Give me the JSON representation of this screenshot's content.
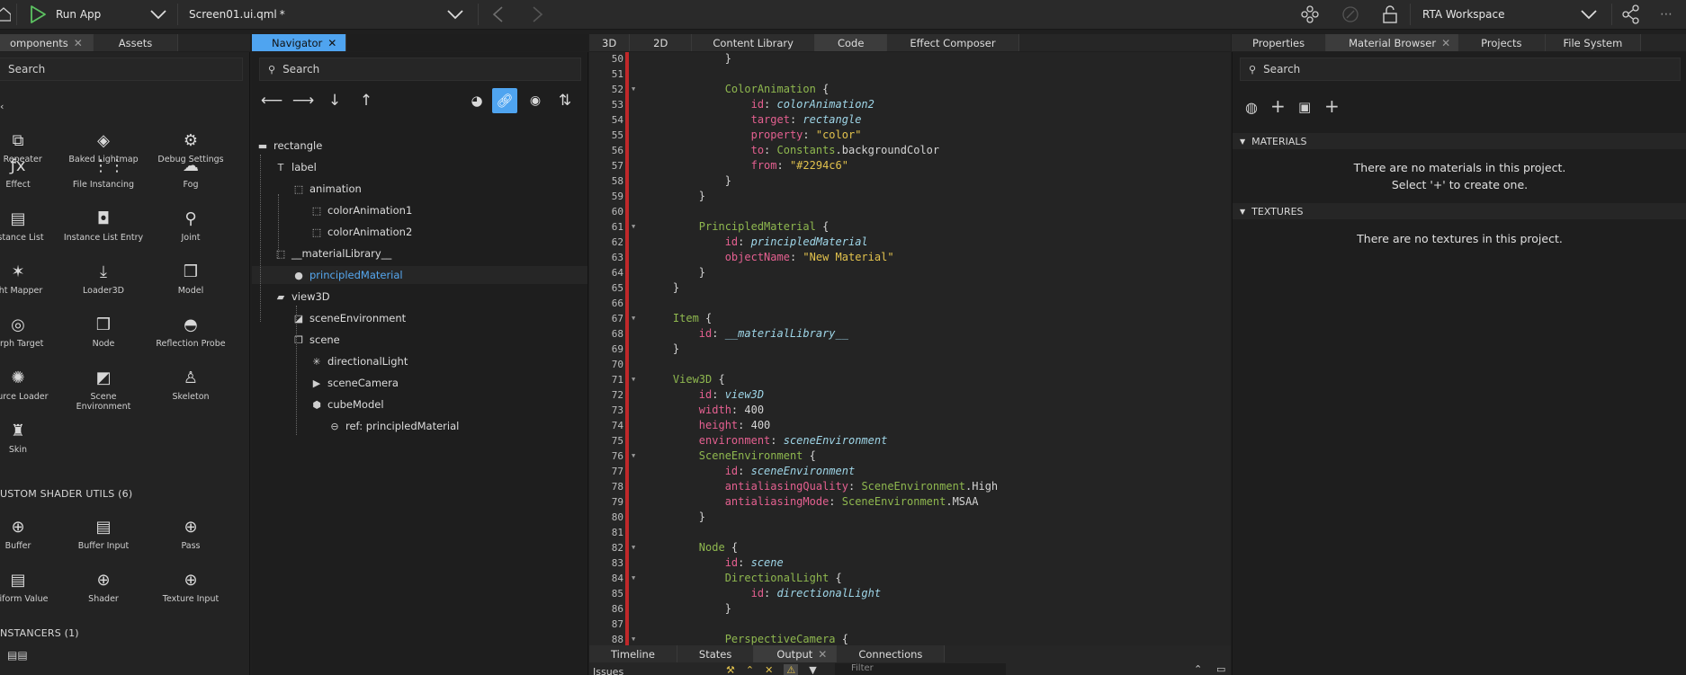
{
  "toolbar": {
    "run_label": "Run App",
    "file": "Screen01.ui.qml",
    "file_modified": "*",
    "workspace": "RTA Workspace"
  },
  "left_tabs": [
    "omponents",
    "Assets"
  ],
  "left_search": "Search",
  "components": [
    {
      "label": "D Repeater",
      "icon": "repeater-icon"
    },
    {
      "label": "Baked Lightmap",
      "icon": "baked-lightmap-icon"
    },
    {
      "label": "Debug Settings",
      "icon": "debug-settings-icon"
    },
    {
      "label": "Effect",
      "icon": "effect-icon"
    },
    {
      "label": "File Instancing",
      "icon": "file-instancing-icon"
    },
    {
      "label": "Fog",
      "icon": "fog-icon"
    },
    {
      "label": "nstance List",
      "icon": "instance-list-icon"
    },
    {
      "label": "Instance List Entry",
      "icon": "instance-list-entry-icon"
    },
    {
      "label": "Joint",
      "icon": "joint-icon"
    },
    {
      "label": "ght Mapper",
      "icon": "light-mapper-icon"
    },
    {
      "label": "Loader3D",
      "icon": "loader3d-icon"
    },
    {
      "label": "Model",
      "icon": "model-icon"
    },
    {
      "label": "lorph Target",
      "icon": "morph-target-icon"
    },
    {
      "label": "Node",
      "icon": "node-icon"
    },
    {
      "label": "Reflection Probe",
      "icon": "reflection-probe-icon"
    },
    {
      "label": "source Loader",
      "icon": "resource-loader-icon"
    },
    {
      "label": "Scene Environment",
      "icon": "scene-environment-icon"
    },
    {
      "label": "Skeleton",
      "icon": "skeleton-icon"
    },
    {
      "label": "Skin",
      "icon": "skin-icon"
    }
  ],
  "section_shader": "USTOM SHADER UTILS (6)",
  "shader_items": [
    {
      "label": "Buffer",
      "icon": "buffer-icon"
    },
    {
      "label": "Buffer Input",
      "icon": "buffer-input-icon"
    },
    {
      "label": "Pass",
      "icon": "pass-icon"
    },
    {
      "label": "Uniform Value",
      "icon": "uniform-value-icon"
    },
    {
      "label": "Shader",
      "icon": "shader-icon"
    },
    {
      "label": "Texture Input",
      "icon": "texture-input-icon"
    }
  ],
  "section_instancers": "NSTANCERS (1)",
  "navigator": {
    "tab": "Navigator",
    "search": "Search",
    "tree": [
      {
        "label": "rectangle",
        "icon": "rectangle-icon"
      },
      {
        "label": "label",
        "icon": "text-icon"
      },
      {
        "label": "animation",
        "icon": "animation-icon"
      },
      {
        "label": "colorAnimation1",
        "icon": "color-animation-icon"
      },
      {
        "label": "colorAnimation2",
        "icon": "color-animation-icon"
      },
      {
        "label": "__materialLibrary__",
        "icon": "material-library-icon"
      },
      {
        "label": "principledMaterial",
        "icon": "material-icon"
      },
      {
        "label": "view3D",
        "icon": "view3d-icon"
      },
      {
        "label": "sceneEnvironment",
        "icon": "scene-environment-icon"
      },
      {
        "label": "scene",
        "icon": "scene-icon"
      },
      {
        "label": "directionalLight",
        "icon": "directional-light-icon"
      },
      {
        "label": "sceneCamera",
        "icon": "camera-icon"
      },
      {
        "label": "cubeModel",
        "icon": "cube-model-icon"
      },
      {
        "label": "ref: principledMaterial",
        "icon": "reference-link-icon"
      }
    ]
  },
  "center_tabs": [
    "3D",
    "2D",
    "Content Library",
    "Code",
    "Effect Composer"
  ],
  "code_lines": [
    {
      "n": "50",
      "fold": false,
      "html": "            }"
    },
    {
      "n": "51",
      "fold": false,
      "html": ""
    },
    {
      "n": "52",
      "fold": true,
      "html": "            <span class='t-type'>ColorAnimation</span> {"
    },
    {
      "n": "53",
      "fold": false,
      "html": "                <span class='t-prop'>id</span>: <span class='t-id'>colorAnimation2</span>"
    },
    {
      "n": "54",
      "fold": false,
      "html": "                <span class='t-prop'>target</span>: <span class='t-id'>rectangle</span>"
    },
    {
      "n": "55",
      "fold": false,
      "html": "                <span class='t-prop'>property</span>: <span class='t-str'>\"color\"</span>"
    },
    {
      "n": "56",
      "fold": false,
      "html": "                <span class='t-prop'>to</span>: <span class='t-type'>Constants</span>.backgroundColor"
    },
    {
      "n": "57",
      "fold": false,
      "html": "                <span class='t-prop'>from</span>: <span class='t-str'>\"#2294c6\"</span>"
    },
    {
      "n": "58",
      "fold": false,
      "html": "            }"
    },
    {
      "n": "59",
      "fold": false,
      "html": "        }"
    },
    {
      "n": "60",
      "fold": false,
      "html": ""
    },
    {
      "n": "61",
      "fold": true,
      "html": "        <span class='t-type'>PrincipledMaterial</span> {"
    },
    {
      "n": "62",
      "fold": false,
      "html": "            <span class='t-prop'>id</span>: <span class='t-id'>principledMaterial</span>"
    },
    {
      "n": "63",
      "fold": false,
      "html": "            <span class='t-prop'>objectName</span>: <span class='t-str'>\"New Material\"</span>"
    },
    {
      "n": "64",
      "fold": false,
      "html": "        }"
    },
    {
      "n": "65",
      "fold": false,
      "html": "    }"
    },
    {
      "n": "66",
      "fold": false,
      "html": ""
    },
    {
      "n": "67",
      "fold": true,
      "html": "    <span class='t-type'>Item</span> {"
    },
    {
      "n": "68",
      "fold": false,
      "html": "        <span class='t-prop'>id</span>: <span class='t-id'>__materialLibrary__</span>"
    },
    {
      "n": "69",
      "fold": false,
      "html": "    }"
    },
    {
      "n": "70",
      "fold": false,
      "html": ""
    },
    {
      "n": "71",
      "fold": true,
      "html": "    <span class='t-type'>View3D</span> {"
    },
    {
      "n": "72",
      "fold": false,
      "html": "        <span class='t-prop'>id</span>: <span class='t-id'>view3D</span>"
    },
    {
      "n": "73",
      "fold": false,
      "html": "        <span class='t-prop'>width</span>: 400"
    },
    {
      "n": "74",
      "fold": false,
      "html": "        <span class='t-prop'>height</span>: 400"
    },
    {
      "n": "75",
      "fold": false,
      "html": "        <span class='t-prop'>environment</span>: <span class='t-id'>sceneEnvironment</span>"
    },
    {
      "n": "76",
      "fold": true,
      "html": "        <span class='t-type'>SceneEnvironment</span> {"
    },
    {
      "n": "77",
      "fold": false,
      "html": "            <span class='t-prop'>id</span>: <span class='t-id'>sceneEnvironment</span>"
    },
    {
      "n": "78",
      "fold": false,
      "html": "            <span class='t-prop'>antialiasingQuality</span>: <span class='t-type'>SceneEnvironment</span>.High"
    },
    {
      "n": "79",
      "fold": false,
      "html": "            <span class='t-prop'>antialiasingMode</span>: <span class='t-type'>SceneEnvironment</span>.MSAA"
    },
    {
      "n": "80",
      "fold": false,
      "html": "        }"
    },
    {
      "n": "81",
      "fold": false,
      "html": ""
    },
    {
      "n": "82",
      "fold": true,
      "html": "        <span class='t-type'>Node</span> {"
    },
    {
      "n": "83",
      "fold": false,
      "html": "            <span class='t-prop'>id</span>: <span class='t-id'>scene</span>"
    },
    {
      "n": "84",
      "fold": true,
      "html": "            <span class='t-type'>DirectionalLight</span> {"
    },
    {
      "n": "85",
      "fold": false,
      "html": "                <span class='t-prop'>id</span>: <span class='t-id'>directionalLight</span>"
    },
    {
      "n": "86",
      "fold": false,
      "html": "            }"
    },
    {
      "n": "87",
      "fold": false,
      "html": ""
    },
    {
      "n": "88",
      "fold": true,
      "html": "            <span class='t-type'>PerspectiveCamera</span> {"
    }
  ],
  "bottom_tabs": [
    "Timeline",
    "States",
    "Output",
    "Connections"
  ],
  "bottom_issues": "Issues",
  "bottom_filter": "Filter",
  "right_tabs": [
    "Properties",
    "Material Browser",
    "Projects",
    "File System"
  ],
  "right_search": "Search",
  "materials": {
    "header": "MATERIALS",
    "empty1": "There are no materials in this project.",
    "empty2": "Select '+' to create one."
  },
  "textures": {
    "header": "TEXTURES",
    "empty": "There are no textures in this project."
  }
}
